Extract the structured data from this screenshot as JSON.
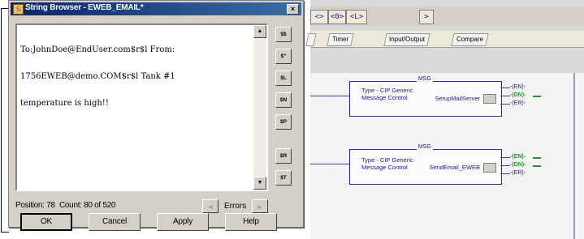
{
  "dialog": {
    "title": "String Browser - EWEB_EMAIL*",
    "text_lines": [
      "To:JohnDoe@EndUser.com$r$l From:",
      "1756EWEB@demo.COM$r$l Tank #1",
      "temperature is high!!"
    ],
    "side_buttons": [
      "$$",
      "$\"",
      "$L",
      "$N",
      "$P",
      "$R",
      "$T"
    ],
    "status": {
      "position": "Position: 78",
      "count": "Count: 80 of 520"
    },
    "errors_label": "Errors",
    "buttons": {
      "ok": "OK",
      "cancel": "Cancel",
      "apply": "Apply",
      "help": "Help"
    }
  },
  "background_window": {
    "toolbar_buttons": [
      "<>",
      "<0>",
      "<L>",
      ">"
    ],
    "tabs": [
      "",
      "Timer",
      "Input/Output",
      "Compare"
    ],
    "rungs": [
      {
        "title": "MSG",
        "type_line1": "Type - CIP Generic",
        "type_line2": "Message Control",
        "tag": "SetupMailServer",
        "bits": [
          "EN",
          "DN",
          "ER"
        ]
      },
      {
        "title": "MSG",
        "type_line1": "Type - CIP Generic",
        "type_line2": "Message Control",
        "tag": "SendEmail_EWEB",
        "bits": [
          "EN",
          "DN",
          "ER"
        ]
      }
    ]
  },
  "colors": {
    "arrow": "#4aa3c4",
    "title_bar": "#0a246a",
    "ladder_blue": "#2a2a9c",
    "status_on": "#1e9a2e"
  }
}
